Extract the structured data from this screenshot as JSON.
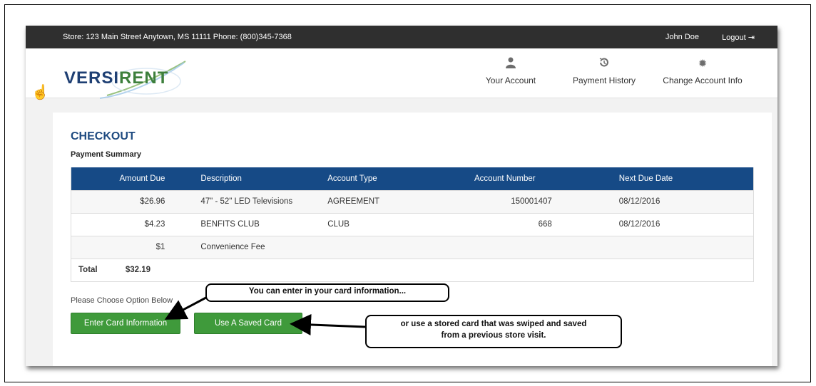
{
  "topbar": {
    "store_info": "Store: 123 Main Street Anytown, MS 11111 Phone: (800)345-7368",
    "user_name": "John Doe",
    "logout_label": "Logout"
  },
  "logo": {
    "text_main": "VERSI",
    "text_accent": "RENT"
  },
  "nav": [
    {
      "label": "Your Account",
      "icon": "user-icon"
    },
    {
      "label": "Payment History",
      "icon": "history-icon"
    },
    {
      "label": "Change Account Info",
      "icon": "gear-icon"
    }
  ],
  "checkout": {
    "title": "CHECKOUT",
    "summary_title": "Payment Summary",
    "columns": [
      "Amount Due",
      "Description",
      "Account Type",
      "Account Number",
      "Next Due Date"
    ],
    "rows": [
      [
        "$26.96",
        "47\" - 52\" LED Televisions",
        "AGREEMENT",
        "150001407",
        "08/12/2016"
      ],
      [
        "$4.23",
        "BENFITS CLUB",
        "CLUB",
        "668",
        "08/12/2016"
      ],
      [
        "$1",
        "Convenience Fee",
        "",
        "",
        ""
      ]
    ],
    "total_label": "Total",
    "total_value": "$32.19",
    "choose_text": "Please Choose Option Below",
    "enter_card_label": "Enter Card Information",
    "saved_card_label": "Use A Saved Card"
  },
  "callouts": {
    "first": "You can enter in your card information...",
    "second_line1": "or use a stored card that was swiped and saved",
    "second_line2": "from a previous store visit."
  },
  "colors": {
    "header_blue": "#164a86",
    "title_blue": "#1e4a80",
    "button_green": "#3f9a3b",
    "topbar": "#2f2f2f"
  }
}
